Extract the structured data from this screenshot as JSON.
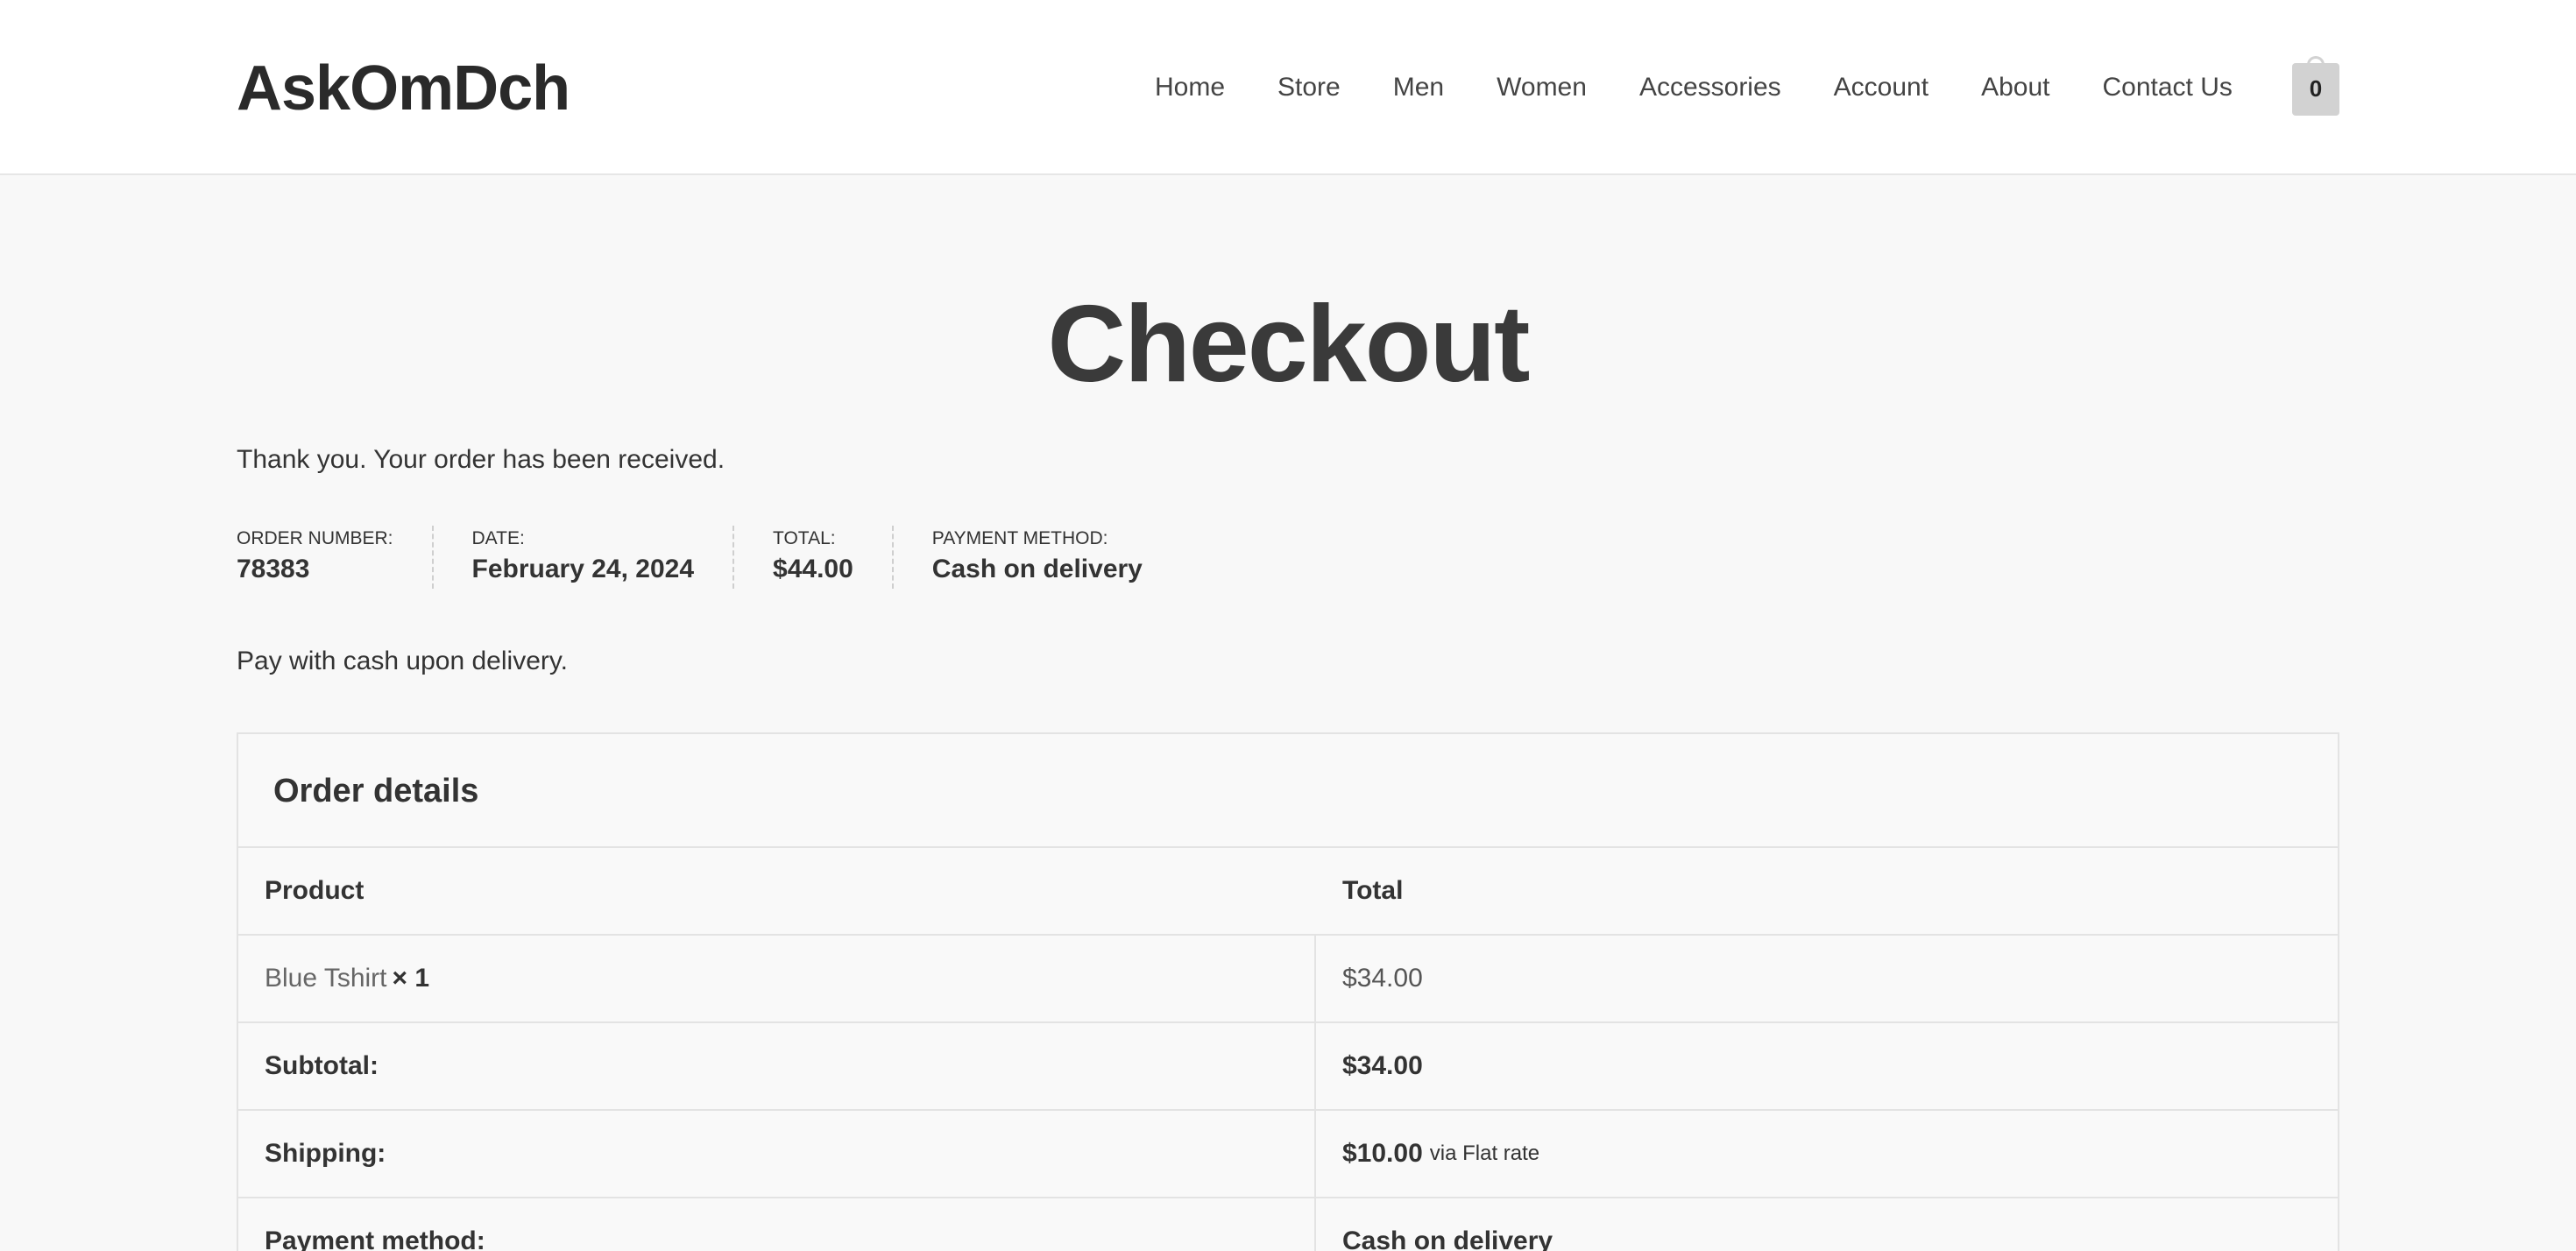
{
  "site": {
    "logo": "AskOmDch",
    "nav": [
      "Home",
      "Store",
      "Men",
      "Women",
      "Accessories",
      "Account",
      "About",
      "Contact Us"
    ],
    "cart_count": "0"
  },
  "page": {
    "title": "Checkout",
    "thanks": "Thank you. Your order has been received.",
    "pay_note": "Pay with cash upon delivery."
  },
  "overview": [
    {
      "label": "Order number:",
      "value": "78383"
    },
    {
      "label": "Date:",
      "value": "February 24, 2024"
    },
    {
      "label": "Total:",
      "value": "$44.00"
    },
    {
      "label": "Payment method:",
      "value": "Cash on delivery"
    }
  ],
  "order_details": {
    "heading": "Order details",
    "columns": [
      "Product",
      "Total"
    ],
    "item": {
      "name": "Blue Tshirt",
      "qty": "× 1",
      "total": "$34.00"
    },
    "subtotal": {
      "label": "Subtotal:",
      "value": "$34.00"
    },
    "shipping": {
      "label": "Shipping:",
      "value": "$10.00",
      "via": "via Flat rate"
    },
    "payment": {
      "label": "Payment method:",
      "value": "Cash on delivery"
    }
  }
}
